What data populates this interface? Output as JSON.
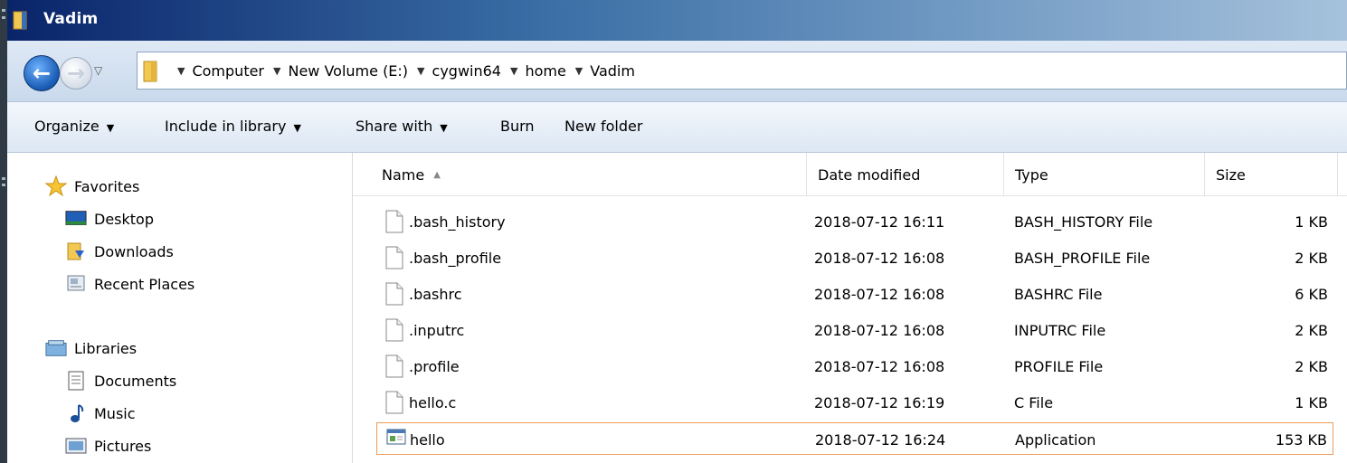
{
  "window": {
    "title": "Vadim"
  },
  "address": {
    "breadcrumbs": [
      "Computer",
      "New Volume (E:)",
      "cygwin64",
      "home",
      "Vadim"
    ]
  },
  "toolbar": {
    "organize": "Organize",
    "include_in_library": "Include in library",
    "share_with": "Share with",
    "burn": "Burn",
    "new_folder": "New folder"
  },
  "nav": {
    "favorites": {
      "label": "Favorites",
      "icon": "star-icon"
    },
    "favorites_items": [
      {
        "label": "Desktop",
        "icon": "desktop-icon"
      },
      {
        "label": "Downloads",
        "icon": "downloads-folder-icon"
      },
      {
        "label": "Recent Places",
        "icon": "recent-places-icon"
      }
    ],
    "libraries": {
      "label": "Libraries",
      "icon": "libraries-icon"
    },
    "libraries_items": [
      {
        "label": "Documents",
        "icon": "documents-icon"
      },
      {
        "label": "Music",
        "icon": "music-icon"
      },
      {
        "label": "Pictures",
        "icon": "pictures-icon"
      }
    ]
  },
  "columns": {
    "name": "Name",
    "date_modified": "Date modified",
    "type": "Type",
    "size": "Size"
  },
  "files": [
    {
      "name": ".bash_history",
      "date": "2018-07-12 16:11",
      "type": "BASH_HISTORY File",
      "size": "1 KB",
      "icon": "file-icon"
    },
    {
      "name": ".bash_profile",
      "date": "2018-07-12 16:08",
      "type": "BASH_PROFILE File",
      "size": "2 KB",
      "icon": "file-icon"
    },
    {
      "name": ".bashrc",
      "date": "2018-07-12 16:08",
      "type": "BASHRC File",
      "size": "6 KB",
      "icon": "file-icon"
    },
    {
      "name": ".inputrc",
      "date": "2018-07-12 16:08",
      "type": "INPUTRC File",
      "size": "2 KB",
      "icon": "file-icon"
    },
    {
      "name": ".profile",
      "date": "2018-07-12 16:08",
      "type": "PROFILE File",
      "size": "2 KB",
      "icon": "file-icon"
    },
    {
      "name": "hello.c",
      "date": "2018-07-12 16:19",
      "type": "C File",
      "size": "1 KB",
      "icon": "file-icon"
    },
    {
      "name": "hello",
      "date": "2018-07-12 16:24",
      "type": "Application",
      "size": "153 KB",
      "icon": "application-icon",
      "selected": true
    }
  ],
  "colors": {
    "title_bar": "#0a246a",
    "selection_border": "#ef9b5a",
    "toolbar_bg": "#dce7f4"
  }
}
